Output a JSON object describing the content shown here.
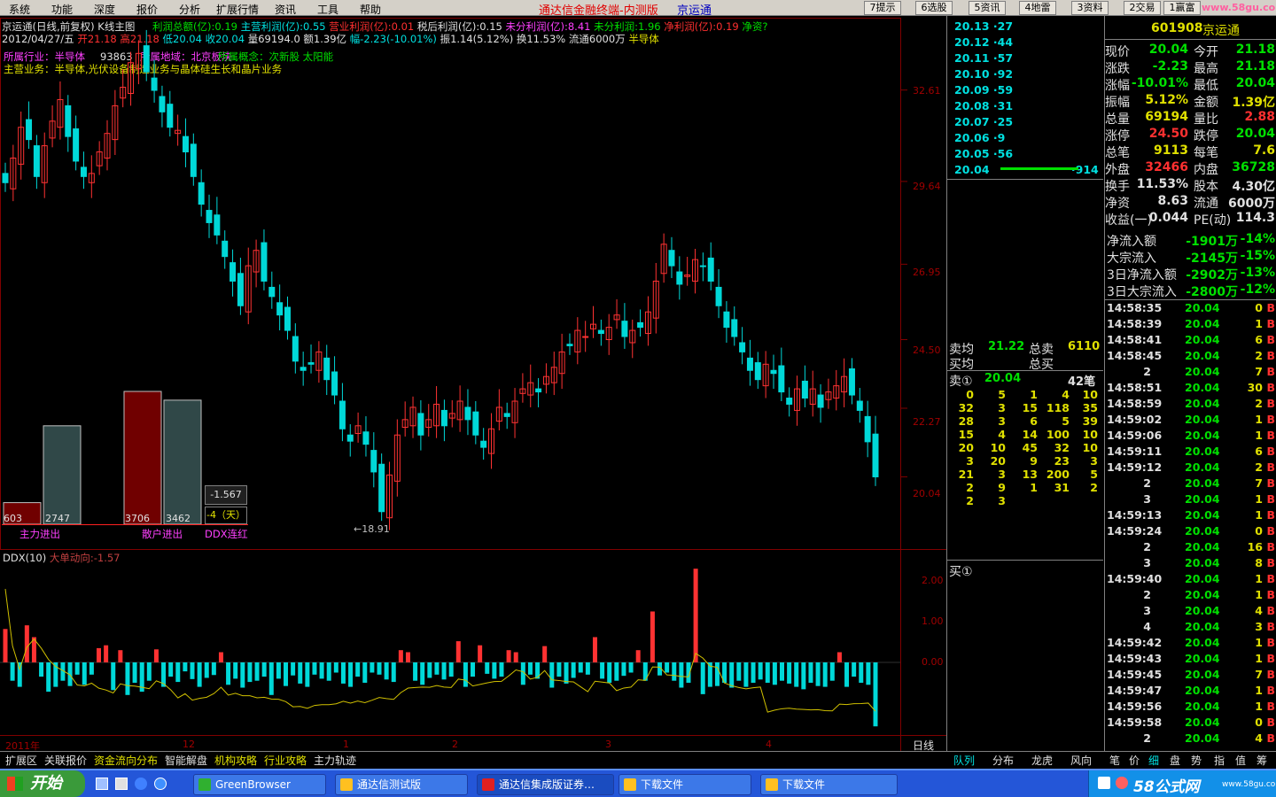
{
  "window": {
    "title": "通达信金融终端-内测版",
    "stock_name": "京运通"
  },
  "menu": [
    "系统",
    "功能",
    "深度",
    "报价",
    "分析",
    "扩展行情",
    "资讯",
    "工具",
    "帮助"
  ],
  "toolbar_buttons": [
    "7提示",
    "6选股",
    "5资讯",
    "4地雷",
    "3资料",
    "2交易",
    "1赢富"
  ],
  "watermark": "www.58gu.com",
  "chart_header": {
    "line1_title": "京运通(日线,前复权) K线主图",
    "fin": [
      {
        "label": "利润总额(亿)",
        "value": "0.19"
      },
      {
        "label": "主营利润(亿)",
        "value": "0.55"
      },
      {
        "label": "营业利润(亿)",
        "value": "0.01"
      },
      {
        "label": "税后利润(亿)",
        "value": "0.15"
      },
      {
        "label": "未分利润(亿)",
        "value": "8.41"
      },
      {
        "label": "未分利润",
        "value": "1.96"
      },
      {
        "label": "净利润(亿)",
        "value": "0.19"
      },
      {
        "label": "净资?",
        "value": ""
      }
    ],
    "line2": {
      "date": "2012/04/27/五",
      "open": "开21.18",
      "high": "高21.18",
      "low": "低20.04",
      "close": "收20.04",
      "vol": "量69194.0",
      "amount": "额1.39亿",
      "chg": "幅-2.23(-10.01%)",
      "amp": "振1.14(5.12%)",
      "turn": "换11.53%",
      "float": "流通6000万",
      "industry": "半导体"
    },
    "industry": "所属行业：半导体",
    "region": "所属地域：北京板块",
    "concept": "所属概念：次新股 太阳能",
    "main_business": "主营业务：半导体,光伏设备制造业务与晶体硅生长和晶片业务",
    "overlay_fragment": "93863"
  },
  "price_axis": [
    "32.61",
    "29.64",
    "26.95",
    "24.50",
    "22.27",
    "20.04"
  ],
  "annotations": {
    "low_marker": "←18.91"
  },
  "flow_bars": {
    "values": [
      603,
      2747,
      3706,
      3462
    ],
    "labels": [
      "主力进出",
      "散户进出",
      "DDX连红"
    ],
    "ddx_box": [
      "-1.567",
      "-4（天）"
    ]
  },
  "ddx": {
    "title": "DDX(10)",
    "subtitle": "大单动向:-1.57",
    "axis": [
      "2.00",
      "1.00",
      "0.00"
    ]
  },
  "x_axis": [
    "2011年",
    "12",
    "1",
    "2",
    "3",
    "4"
  ],
  "x_axis_right": "日线",
  "chart_data": {
    "type": "candlestick",
    "title": "京运通(日线,前复权) K线主图",
    "close_last": 20.04,
    "open_last": 21.18,
    "ylim": [
      18.5,
      34.5
    ],
    "y_ticks": [
      32.61,
      29.64,
      26.95,
      24.5,
      22.27,
      20.04
    ],
    "closes": [
      29.6,
      30.4,
      31.4,
      31.0,
      29.8,
      30.8,
      31.6,
      32.3,
      31.1,
      30.3,
      29.8,
      29.9,
      30.6,
      31.2,
      32.1,
      32.7,
      33.5,
      33.8,
      33.2,
      32.6,
      31.9,
      31.4,
      31.3,
      30.6,
      29.8,
      28.9,
      28.3,
      27.9,
      27.2,
      26.4,
      25.6,
      26.9,
      27.4,
      26.4,
      25.9,
      25.3,
      24.8,
      23.8,
      23.5,
      23.7,
      24.1,
      23.2,
      22.7,
      21.6,
      21.2,
      21.7,
      21.1,
      20.2,
      18.91,
      20.1,
      21.4,
      21.9,
      22.3,
      21.4,
      21.9,
      22.4,
      21.7,
      22.1,
      22.5,
      21.9,
      21.4,
      21.0,
      21.6,
      22.3,
      22.0,
      22.5,
      22.9,
      23.1,
      22.8,
      23.3,
      23.6,
      24.1,
      24.3,
      24.8,
      24.6,
      25.0,
      24.7,
      24.9,
      25.3,
      24.6,
      24.8,
      24.9,
      25.4,
      26.4,
      27.6,
      26.9,
      26.3,
      26.6,
      27.1,
      26.9,
      26.4,
      25.6,
      24.9,
      24.6,
      24.1,
      23.5,
      23.2,
      23.7,
      23.4,
      22.8,
      22.4,
      22.9,
      22.6,
      22.9,
      22.3,
      22.8,
      23.0,
      23.3,
      22.7,
      22.2,
      21.18,
      20.04
    ],
    "ddx_values": [
      0.82,
      -0.45,
      -0.6,
      0.91,
      0.62,
      -0.35,
      -0.72,
      -0.6,
      -0.45,
      -0.58,
      -0.3,
      -0.55,
      -0.3,
      0.35,
      0.42,
      -0.68,
      0.3,
      -0.8,
      -0.5,
      -0.72,
      -0.45,
      0.32,
      -0.6,
      -0.35,
      -0.48,
      -0.22,
      -0.41,
      -0.6,
      -0.38,
      -0.31,
      0.25,
      -0.55,
      -0.4,
      -0.62,
      -0.48,
      -0.45,
      -0.35,
      -0.8,
      -0.4,
      -0.58,
      -0.32,
      -0.52,
      -0.6,
      -0.3,
      -0.4,
      -0.45,
      -0.25,
      -0.52,
      -0.6,
      -0.35,
      -0.5,
      -0.25,
      -0.3,
      -0.42,
      -0.48,
      0.3,
      0.25,
      -0.45,
      -0.55,
      -0.38,
      -0.3,
      -0.42,
      -0.35,
      0.52,
      -0.6,
      -0.35,
      0.42,
      -0.28,
      -0.4,
      -0.35,
      0.3,
      0.25,
      -0.55,
      -0.3,
      -0.4,
      0.4,
      -0.62,
      -0.35,
      -0.52,
      -0.38,
      -0.25,
      -0.3,
      0.62,
      -0.4,
      -0.5,
      -0.45,
      -0.33,
      -0.25,
      0.3,
      -0.45,
      1.25,
      -0.32,
      -0.25,
      -0.45,
      -0.62,
      -0.5,
      2.3,
      -0.78,
      -0.6,
      -0.58,
      -0.5,
      -0.62,
      -0.45,
      -0.6,
      -0.5,
      -0.42,
      -0.5,
      -0.55,
      -0.45,
      -0.52,
      -0.6,
      -0.66,
      -0.5,
      -0.58,
      -0.6,
      -0.45,
      0.25,
      -0.6,
      -0.35,
      -0.5,
      -0.55,
      -1.57
    ]
  },
  "quote_panel": {
    "code": "601908",
    "name": "京运通",
    "ask_levels": [
      [
        "20.13",
        "27"
      ],
      [
        "20.12",
        "44"
      ],
      [
        "20.11",
        "57"
      ],
      [
        "20.10",
        "92"
      ],
      [
        "20.09",
        "59"
      ],
      [
        "20.08",
        "31"
      ],
      [
        "20.07",
        "25"
      ],
      [
        "20.06",
        "9"
      ],
      [
        "20.05",
        "56"
      ],
      [
        "20.04",
        "914"
      ]
    ],
    "rows": [
      [
        "现价",
        "20.04",
        "今开",
        "21.18"
      ],
      [
        "涨跌",
        "-2.23",
        "最高",
        "21.18"
      ],
      [
        "涨幅",
        "-10.01%",
        "最低",
        "20.04"
      ],
      [
        "振幅",
        "5.12%",
        "金额",
        "1.39亿"
      ],
      [
        "总量",
        "69194",
        "量比",
        "2.88"
      ],
      [
        "涨停",
        "24.50",
        "跌停",
        "20.04"
      ],
      [
        "总笔",
        "9113",
        "每笔",
        "7.6"
      ],
      [
        "外盘",
        "32466",
        "内盘",
        "36728"
      ],
      [
        "换手",
        "11.53%",
        "股本",
        "4.30亿"
      ],
      [
        "净资",
        "8.63",
        "流通",
        "6000万"
      ],
      [
        "收益(一)",
        "0.044",
        "PE(动)",
        "114.3"
      ]
    ],
    "flow_rows": [
      [
        "净流入额",
        "-1901万",
        "-14%"
      ],
      [
        "大宗流入",
        "-2145万",
        "-15%"
      ],
      [
        "3日净流入额",
        "-2902万",
        "-13%"
      ],
      [
        "3日大宗流入",
        "-2800万",
        "-12%"
      ]
    ]
  },
  "order_panel": {
    "sell_avg_label": "卖均",
    "sell_avg": "21.22",
    "total_sell_label": "总卖",
    "total_sell": "6110",
    "buy_avg_label": "买均",
    "total_buy_label": "总买",
    "sell1_label": "卖①",
    "sell1_price": "20.04",
    "sell1_count": "42笔",
    "queue": [
      [
        "0",
        "5",
        "1",
        "4",
        "10"
      ],
      [
        "32",
        "3",
        "15",
        "118",
        "35"
      ],
      [
        "28",
        "3",
        "6",
        "5",
        "39"
      ],
      [
        "15",
        "4",
        "14",
        "100",
        "10"
      ],
      [
        "20",
        "10",
        "45",
        "32",
        "10"
      ],
      [
        "3",
        "20",
        "9",
        "23",
        "3"
      ],
      [
        "21",
        "3",
        "13",
        "200",
        "5"
      ],
      [
        "2",
        "9",
        "1",
        "31",
        "2"
      ],
      [
        "2",
        "3",
        "",
        "",
        ""
      ]
    ],
    "buy1_label": "买①"
  },
  "trades": [
    [
      "14:58:35",
      "20.04",
      "0",
      "B"
    ],
    [
      "14:58:39",
      "20.04",
      "1",
      "B"
    ],
    [
      "14:58:41",
      "20.04",
      "6",
      "B"
    ],
    [
      "14:58:45",
      "20.04",
      "2",
      "B"
    ],
    [
      "2",
      "20.04",
      "7",
      "B"
    ],
    [
      "14:58:51",
      "20.04",
      "30",
      "B"
    ],
    [
      "14:58:59",
      "20.04",
      "2",
      "B"
    ],
    [
      "14:59:02",
      "20.04",
      "1",
      "B"
    ],
    [
      "14:59:06",
      "20.04",
      "1",
      "B"
    ],
    [
      "14:59:11",
      "20.04",
      "6",
      "B"
    ],
    [
      "14:59:12",
      "20.04",
      "2",
      "B"
    ],
    [
      "2",
      "20.04",
      "7",
      "B"
    ],
    [
      "3",
      "20.04",
      "1",
      "B"
    ],
    [
      "14:59:13",
      "20.04",
      "1",
      "B"
    ],
    [
      "14:59:24",
      "20.04",
      "0",
      "B"
    ],
    [
      "2",
      "20.04",
      "16",
      "B"
    ],
    [
      "3",
      "20.04",
      "8",
      "B"
    ],
    [
      "14:59:40",
      "20.04",
      "1",
      "B"
    ],
    [
      "2",
      "20.04",
      "1",
      "B"
    ],
    [
      "3",
      "20.04",
      "4",
      "B"
    ],
    [
      "4",
      "20.04",
      "3",
      "B"
    ],
    [
      "14:59:42",
      "20.04",
      "1",
      "B"
    ],
    [
      "14:59:43",
      "20.04",
      "1",
      "B"
    ],
    [
      "14:59:45",
      "20.04",
      "7",
      "B"
    ],
    [
      "14:59:47",
      "20.04",
      "1",
      "B"
    ],
    [
      "14:59:56",
      "20.04",
      "1",
      "B"
    ],
    [
      "14:59:58",
      "20.04",
      "0",
      "B"
    ],
    [
      "2",
      "20.04",
      "4",
      "B"
    ]
  ],
  "bottom_tabs_left": [
    "扩展区",
    "关联报价",
    "资金流向分布",
    "智能解盘",
    "机构攻略",
    "行业攻略",
    "主力轨迹"
  ],
  "bottom_tabs_mid": [
    "队列",
    "分布",
    "龙虎",
    "风向"
  ],
  "bottom_tabs_right": [
    "笔",
    "价",
    "细",
    "盘",
    "势",
    "指",
    "值",
    "筹"
  ],
  "taskbar": {
    "start": "开始",
    "tasks": [
      "GreenBrowser",
      "通达信测试版",
      "通达信集成版证券…",
      "下载文件",
      "下载文件"
    ],
    "tray_brand": "58公式网",
    "tray_url": "www.58gu.com"
  },
  "colors": {
    "up": "#ff3232",
    "down": "#00d8d8",
    "bg": "#000000",
    "axis": "#800000"
  }
}
